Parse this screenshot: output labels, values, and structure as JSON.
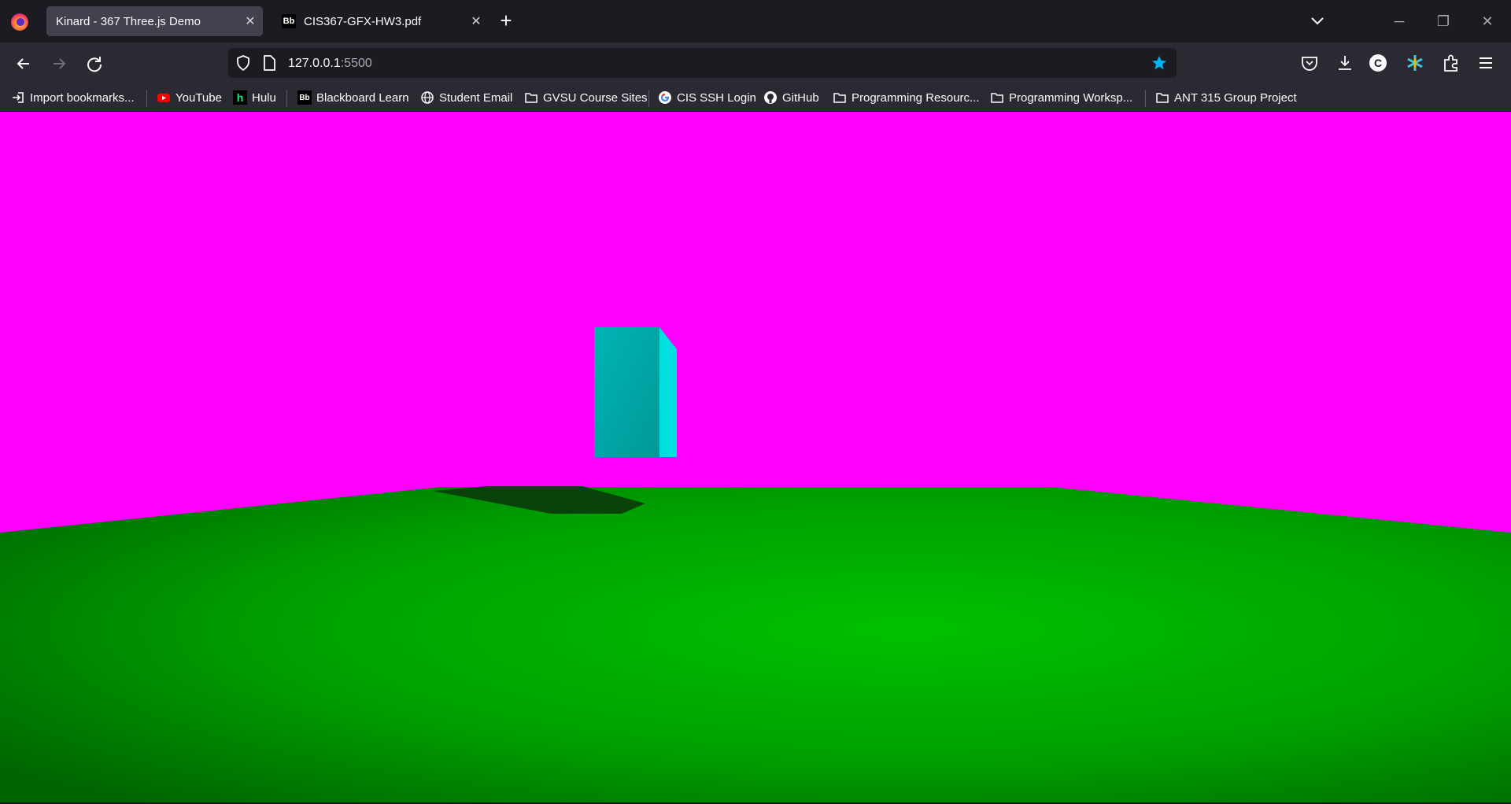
{
  "tabs": [
    {
      "title": "Kinard - 367 Three.js Demo",
      "active": true
    },
    {
      "title": "CIS367-GFX-HW3.pdf",
      "active": false,
      "favicon": "Bb"
    }
  ],
  "address": {
    "host": "127.0.0.1",
    "port": ":5500"
  },
  "bookmarks": [
    {
      "label": "Import bookmarks...",
      "icon": "import-icon"
    },
    {
      "label": "YouTube",
      "icon": "youtube-icon"
    },
    {
      "label": "Hulu",
      "icon": "hulu-icon"
    },
    {
      "label": "Blackboard Learn",
      "icon": "blackboard-icon"
    },
    {
      "label": "Student Email",
      "icon": "globe-icon"
    },
    {
      "label": "GVSU Course Sites",
      "icon": "folder-icon"
    },
    {
      "label": "CIS SSH Login",
      "icon": "google-icon"
    },
    {
      "label": "GitHub",
      "icon": "github-icon"
    },
    {
      "label": "Programming Resourc...",
      "icon": "folder-icon"
    },
    {
      "label": "Programming Worksp...",
      "icon": "folder-icon"
    },
    {
      "label": "ANT 315 Group Project",
      "icon": "folder-icon"
    }
  ],
  "icons": {
    "hulu_letter": "h",
    "bb_letter": "Bb",
    "extension_letter": "C"
  },
  "colors": {
    "sky": "#ff00ff",
    "ground": "#00b800",
    "cube_front": "#00a8a8",
    "cube_side": "#00e0e0",
    "shadow": "#0a3a0a",
    "bookmark_star": "#00b3f4"
  }
}
